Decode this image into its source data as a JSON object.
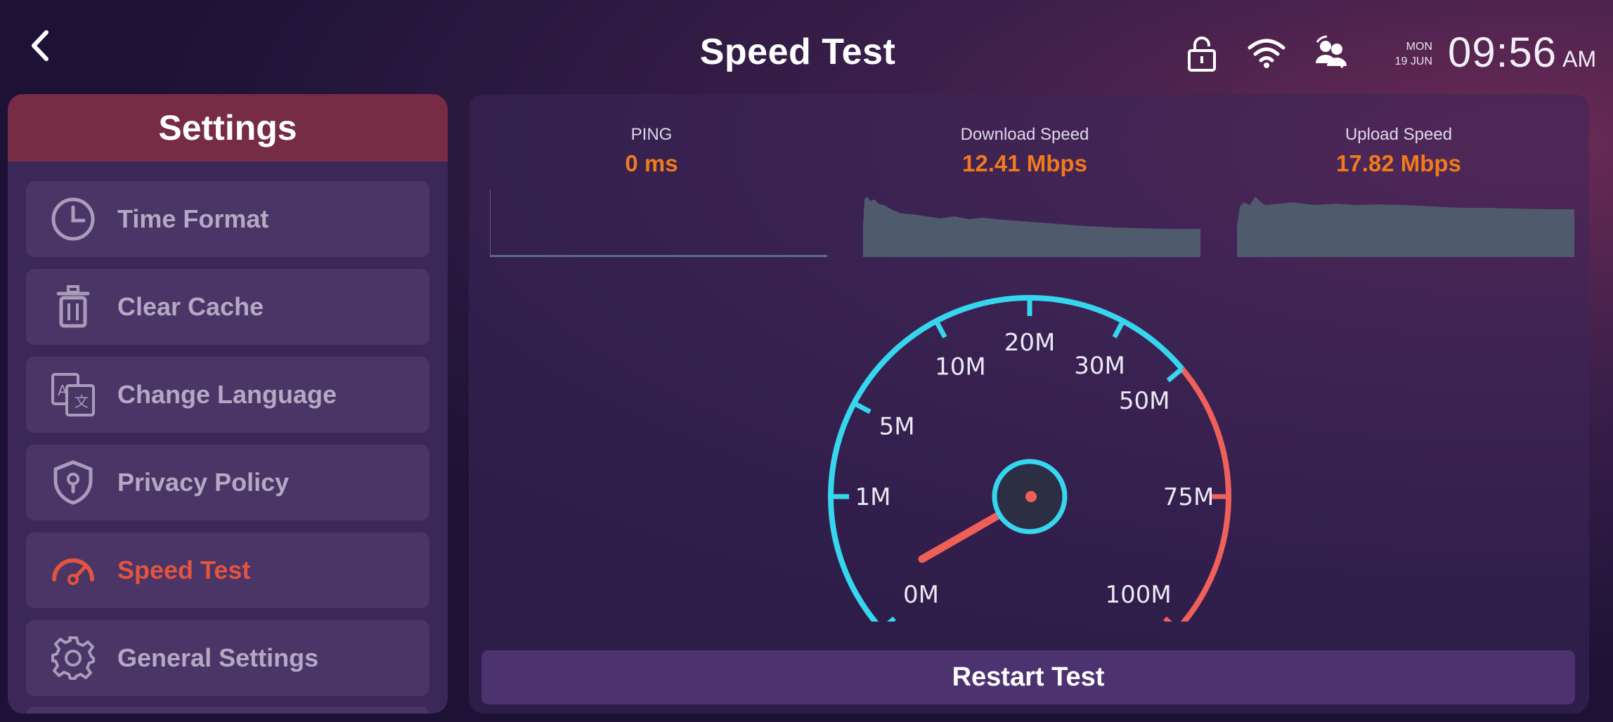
{
  "header": {
    "title": "Speed Test",
    "date_day": "MON",
    "date_date": "19 JUN",
    "time": "09:56",
    "ampm": "AM",
    "icons": [
      "back-icon",
      "lock-icon",
      "wifi-icon",
      "users-sync-icon"
    ]
  },
  "sidebar": {
    "title": "Settings",
    "items": [
      {
        "label": "Time Format",
        "icon": "clock-icon",
        "active": false
      },
      {
        "label": "Clear Cache",
        "icon": "trash-icon",
        "active": false
      },
      {
        "label": "Change Language",
        "icon": "translate-icon",
        "active": false
      },
      {
        "label": "Privacy Policy",
        "icon": "shield-keyhole-icon",
        "active": false
      },
      {
        "label": "Speed Test",
        "icon": "speedometer-icon",
        "active": true
      },
      {
        "label": "General Settings",
        "icon": "gear-icon",
        "active": false
      }
    ]
  },
  "metrics": {
    "ping": {
      "label": "PING",
      "value": "0 ms"
    },
    "download": {
      "label": "Download Speed",
      "value": "12.41 Mbps"
    },
    "upload": {
      "label": "Upload Speed",
      "value": "17.82 Mbps"
    }
  },
  "gauge": {
    "ticks": [
      "0M",
      "1M",
      "5M",
      "10M",
      "20M",
      "30M",
      "50M",
      "75M",
      "100M"
    ],
    "needle_value_label": "0M"
  },
  "actions": {
    "restart_label": "Restart Test"
  },
  "colors": {
    "accent_orange": "#f07a1c",
    "active_red": "#e2543f",
    "gauge_cyan": "#36d6ee",
    "gauge_red": "#f0605a",
    "header_red": "#772c45"
  }
}
